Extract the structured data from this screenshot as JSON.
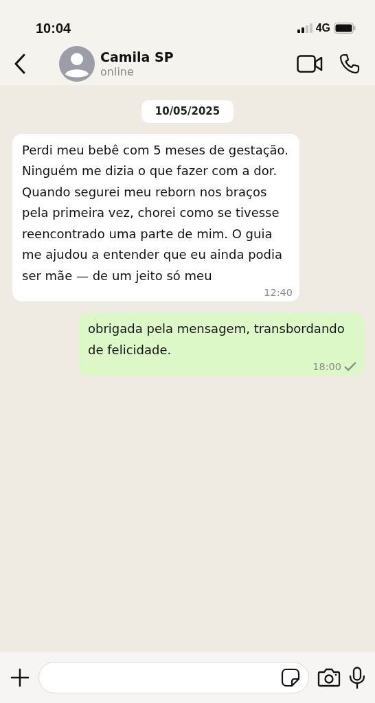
{
  "status_bar": {
    "time": "10:04",
    "network": "4G"
  },
  "header": {
    "name": "Camila SP",
    "status": "online"
  },
  "date_chip": "10/05/2025",
  "messages": [
    {
      "kind": "incoming",
      "text": "Perdi meu bebê com 5 meses de gestação. Ninguém me dizia o que fazer com a dor. Quando segurei meu reborn nos braços pela primeira vez, chorei como se tivesse reencontrado uma parte de mim. O guia me ajudou a entender que eu ainda podia ser mãe — de um jeito só meu",
      "time": "12:40"
    },
    {
      "kind": "outgoing",
      "text": "obrigada pela mensagem, transbordando de felicidade.",
      "time": "18:00",
      "sent": true
    }
  ]
}
